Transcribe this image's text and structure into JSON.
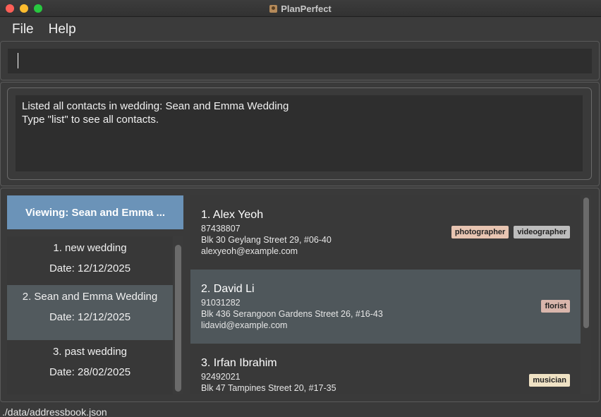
{
  "window": {
    "title": "PlanPerfect"
  },
  "menu": {
    "file": "File",
    "help": "Help"
  },
  "command": {
    "value": ""
  },
  "result": {
    "line1": "Listed all contacts in wedding: Sean and Emma Wedding",
    "line2": "Type \"list\" to see all contacts."
  },
  "weddings": {
    "header": "Viewing: Sean and Emma ...",
    "items": [
      {
        "name": "1. new wedding",
        "date": "Date: 12/12/2025"
      },
      {
        "name": "2. Sean and Emma Wedding",
        "date": "Date: 12/12/2025"
      },
      {
        "name": "3. past wedding",
        "date": "Date: 28/02/2025"
      }
    ]
  },
  "persons": [
    {
      "name": "1. Alex Yeoh",
      "phone": "87438807",
      "address": "Blk 30 Geylang Street 29, #06-40",
      "email": "alexyeoh@example.com",
      "tags": [
        {
          "label": "photographer",
          "color": "#e8c5b2"
        },
        {
          "label": "videographer",
          "color": "#bdbdbd"
        }
      ]
    },
    {
      "name": "2. David Li",
      "phone": "91031282",
      "address": "Blk 436 Serangoon Gardens Street 26, #16-43",
      "email": "lidavid@example.com",
      "tags": [
        {
          "label": "florist",
          "color": "#d9b6ac"
        }
      ]
    },
    {
      "name": "3. Irfan Ibrahim",
      "phone": "92492021",
      "address": "Blk 47 Tampines Street 20, #17-35",
      "email": "",
      "tags": [
        {
          "label": "musician",
          "color": "#efe2c4"
        }
      ]
    }
  ],
  "status": {
    "path": "./data/addressbook.json"
  }
}
